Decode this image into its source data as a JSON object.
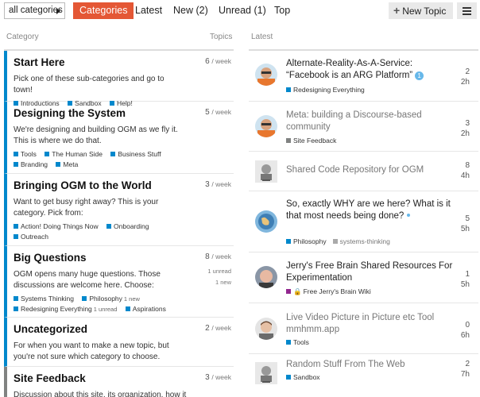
{
  "nav": {
    "category_dropdown": "all categories",
    "tabs": [
      "Categories",
      "Latest",
      "New (2)",
      "Unread (1)",
      "Top"
    ],
    "new_topic_label": "New Topic"
  },
  "columns": {
    "category": "Category",
    "topics": "Topics",
    "latest": "Latest"
  },
  "categories": [
    {
      "name": "Start Here",
      "stat": "6",
      "per": "/ week",
      "desc": "Pick one of these sub-categories and go to town!",
      "subcats": [
        "Introductions",
        "Sandbox",
        "Help!"
      ]
    },
    {
      "name": "Designing the System",
      "stat": "5",
      "per": "/ week",
      "desc": "We're designing and building OGM as we fly it. This is where we do that.",
      "subcats": [
        "Tools",
        "The Human Side",
        "Business Stuff",
        "Branding",
        "Meta"
      ]
    },
    {
      "name": "Bringing OGM to the World",
      "stat": "3",
      "per": "/ week",
      "desc": "Want to get busy right away? This is your category. Pick from:",
      "subcats": [
        "Action! Doing Things Now",
        "Onboarding",
        "Outreach"
      ]
    },
    {
      "name": "Big Questions",
      "stat": "8",
      "per": "/ week",
      "unread": "1 unread",
      "new": "1 new",
      "desc": "OGM opens many huge questions. Those discussions are welcome here. Choose:",
      "subcats": [
        "Systems Thinking",
        "Philosophy",
        "Redesigning Everything",
        "Aspirations"
      ],
      "subcat_notes": {
        "philosophy": "1 new",
        "redesigning": "1 unread"
      }
    },
    {
      "name": "Uncategorized",
      "stat": "2",
      "per": "/ week",
      "desc": "For when you want to make a new topic, but you're not sure which category to choose.",
      "subcats": []
    },
    {
      "name": "Site Feedback",
      "stat": "3",
      "per": "/ week",
      "desc": "Discussion about this site, its organization, how it",
      "subcats": []
    }
  ],
  "topics": [
    {
      "title": "Alternate-Reality-As-A-Service: “Facebook is an ARG Platform”",
      "badge": "1",
      "category": "Redesigning Everything",
      "replies": "2",
      "ago": "2h",
      "avatar": "orange-shirt-man"
    },
    {
      "title": "Meta: building a Discourse-based community",
      "category": "Site Feedback",
      "replies": "3",
      "ago": "2h",
      "avatar": "orange-shirt-man"
    },
    {
      "title": "Shared Code Repository for OGM",
      "category": "",
      "replies": "8",
      "ago": "4h",
      "avatar": "sketch-portrait"
    },
    {
      "title": "So, exactly WHY are we here? What is it that most needs being done?",
      "category": "Philosophy",
      "category2": "systems-thinking",
      "replies": "5",
      "ago": "5h",
      "avatar": "globe-avatar"
    },
    {
      "title": "Jerry's Free Brain Shared Resources For Experimentation",
      "category": "Free Jerry's Brain Wiki",
      "replies": "1",
      "ago": "5h",
      "avatar": "bald-man"
    },
    {
      "title": "Live Video Picture in Picture etc Tool mmhmm.app",
      "category": "Tools",
      "replies": "0",
      "ago": "6h",
      "avatar": "young-man"
    },
    {
      "title": "Random Stuff From The Web",
      "category": "Sandbox",
      "replies": "2",
      "ago": "7h",
      "avatar": "sketch-portrait"
    }
  ],
  "colors": {
    "accent": "#e45735",
    "category_blue": "#0088cc",
    "site_feedback_gray": "#808281",
    "free_brain_purple": "#92278f",
    "badge_blue": "#67b8ea"
  }
}
